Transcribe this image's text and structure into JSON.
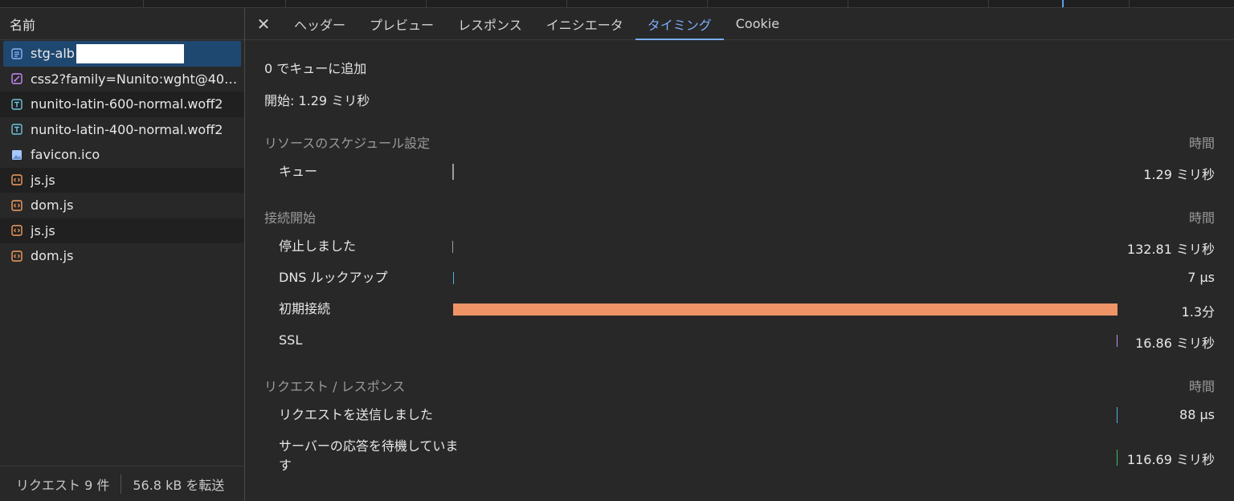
{
  "request_list": {
    "header": "名前",
    "rows": [
      {
        "name": "stg-alb",
        "icon": "document-icon",
        "icon_color": "#8ab4f8",
        "redacted": true,
        "selected": true
      },
      {
        "name": "css2?family=Nunito:wght@40…",
        "icon": "stylesheet-icon",
        "icon_color": "#c58af9"
      },
      {
        "name": "nunito-latin-600-normal.woff2",
        "icon": "font-icon",
        "icon_color": "#6fc5e0"
      },
      {
        "name": "nunito-latin-400-normal.woff2",
        "icon": "font-icon",
        "icon_color": "#6fc5e0"
      },
      {
        "name": "favicon.ico",
        "icon": "image-icon",
        "icon_color": "#a8c7fa"
      },
      {
        "name": "js.js",
        "icon": "script-icon",
        "icon_color": "#f29d60"
      },
      {
        "name": "dom.js",
        "icon": "script-icon",
        "icon_color": "#f29d60"
      },
      {
        "name": "js.js",
        "icon": "script-icon",
        "icon_color": "#f29d60"
      },
      {
        "name": "dom.js",
        "icon": "script-icon",
        "icon_color": "#f29d60"
      }
    ],
    "footer": {
      "requests": "リクエスト 9 件",
      "transferred": "56.8 kB を転送"
    }
  },
  "tabs": {
    "close_icon": "close-icon",
    "items": [
      "ヘッダー",
      "プレビュー",
      "レスポンス",
      "イニシエータ",
      "タイミング",
      "Cookie"
    ],
    "active": "タイミング"
  },
  "timing": {
    "queued_at": "0 でキューに追加",
    "started_at": "開始: 1.29 ミリ秒",
    "sections": [
      {
        "title": "リソースのスケジュール設定",
        "time_header": "時間",
        "rows": [
          {
            "label": "キュー",
            "value": "1.29 ミリ秒"
          }
        ]
      },
      {
        "title": "接続開始",
        "time_header": "時間",
        "rows": [
          {
            "label": "停止しました",
            "value": "132.81 ミリ秒"
          },
          {
            "label": "DNS ルックアップ",
            "value": "7 μs"
          },
          {
            "label": "初期接続",
            "value": "1.3分"
          },
          {
            "label": "SSL",
            "value": "16.86 ミリ秒"
          }
        ]
      },
      {
        "title": "リクエスト / レスポンス",
        "time_header": "時間",
        "rows": [
          {
            "label": "リクエストを送信しました",
            "value": "88 μs"
          },
          {
            "label": "サーバーの応答を待機しています",
            "value": "116.69 ミリ秒"
          }
        ]
      }
    ],
    "bar_colors": {
      "queue": "#9e9e9e",
      "stalled": "#9e9e9e",
      "dns": "#4fb3d9",
      "initial_connection": "#ee9466",
      "ssl": "#c58af9",
      "request_sent": "#4fb3d9",
      "waiting": "#3fb86a"
    }
  }
}
